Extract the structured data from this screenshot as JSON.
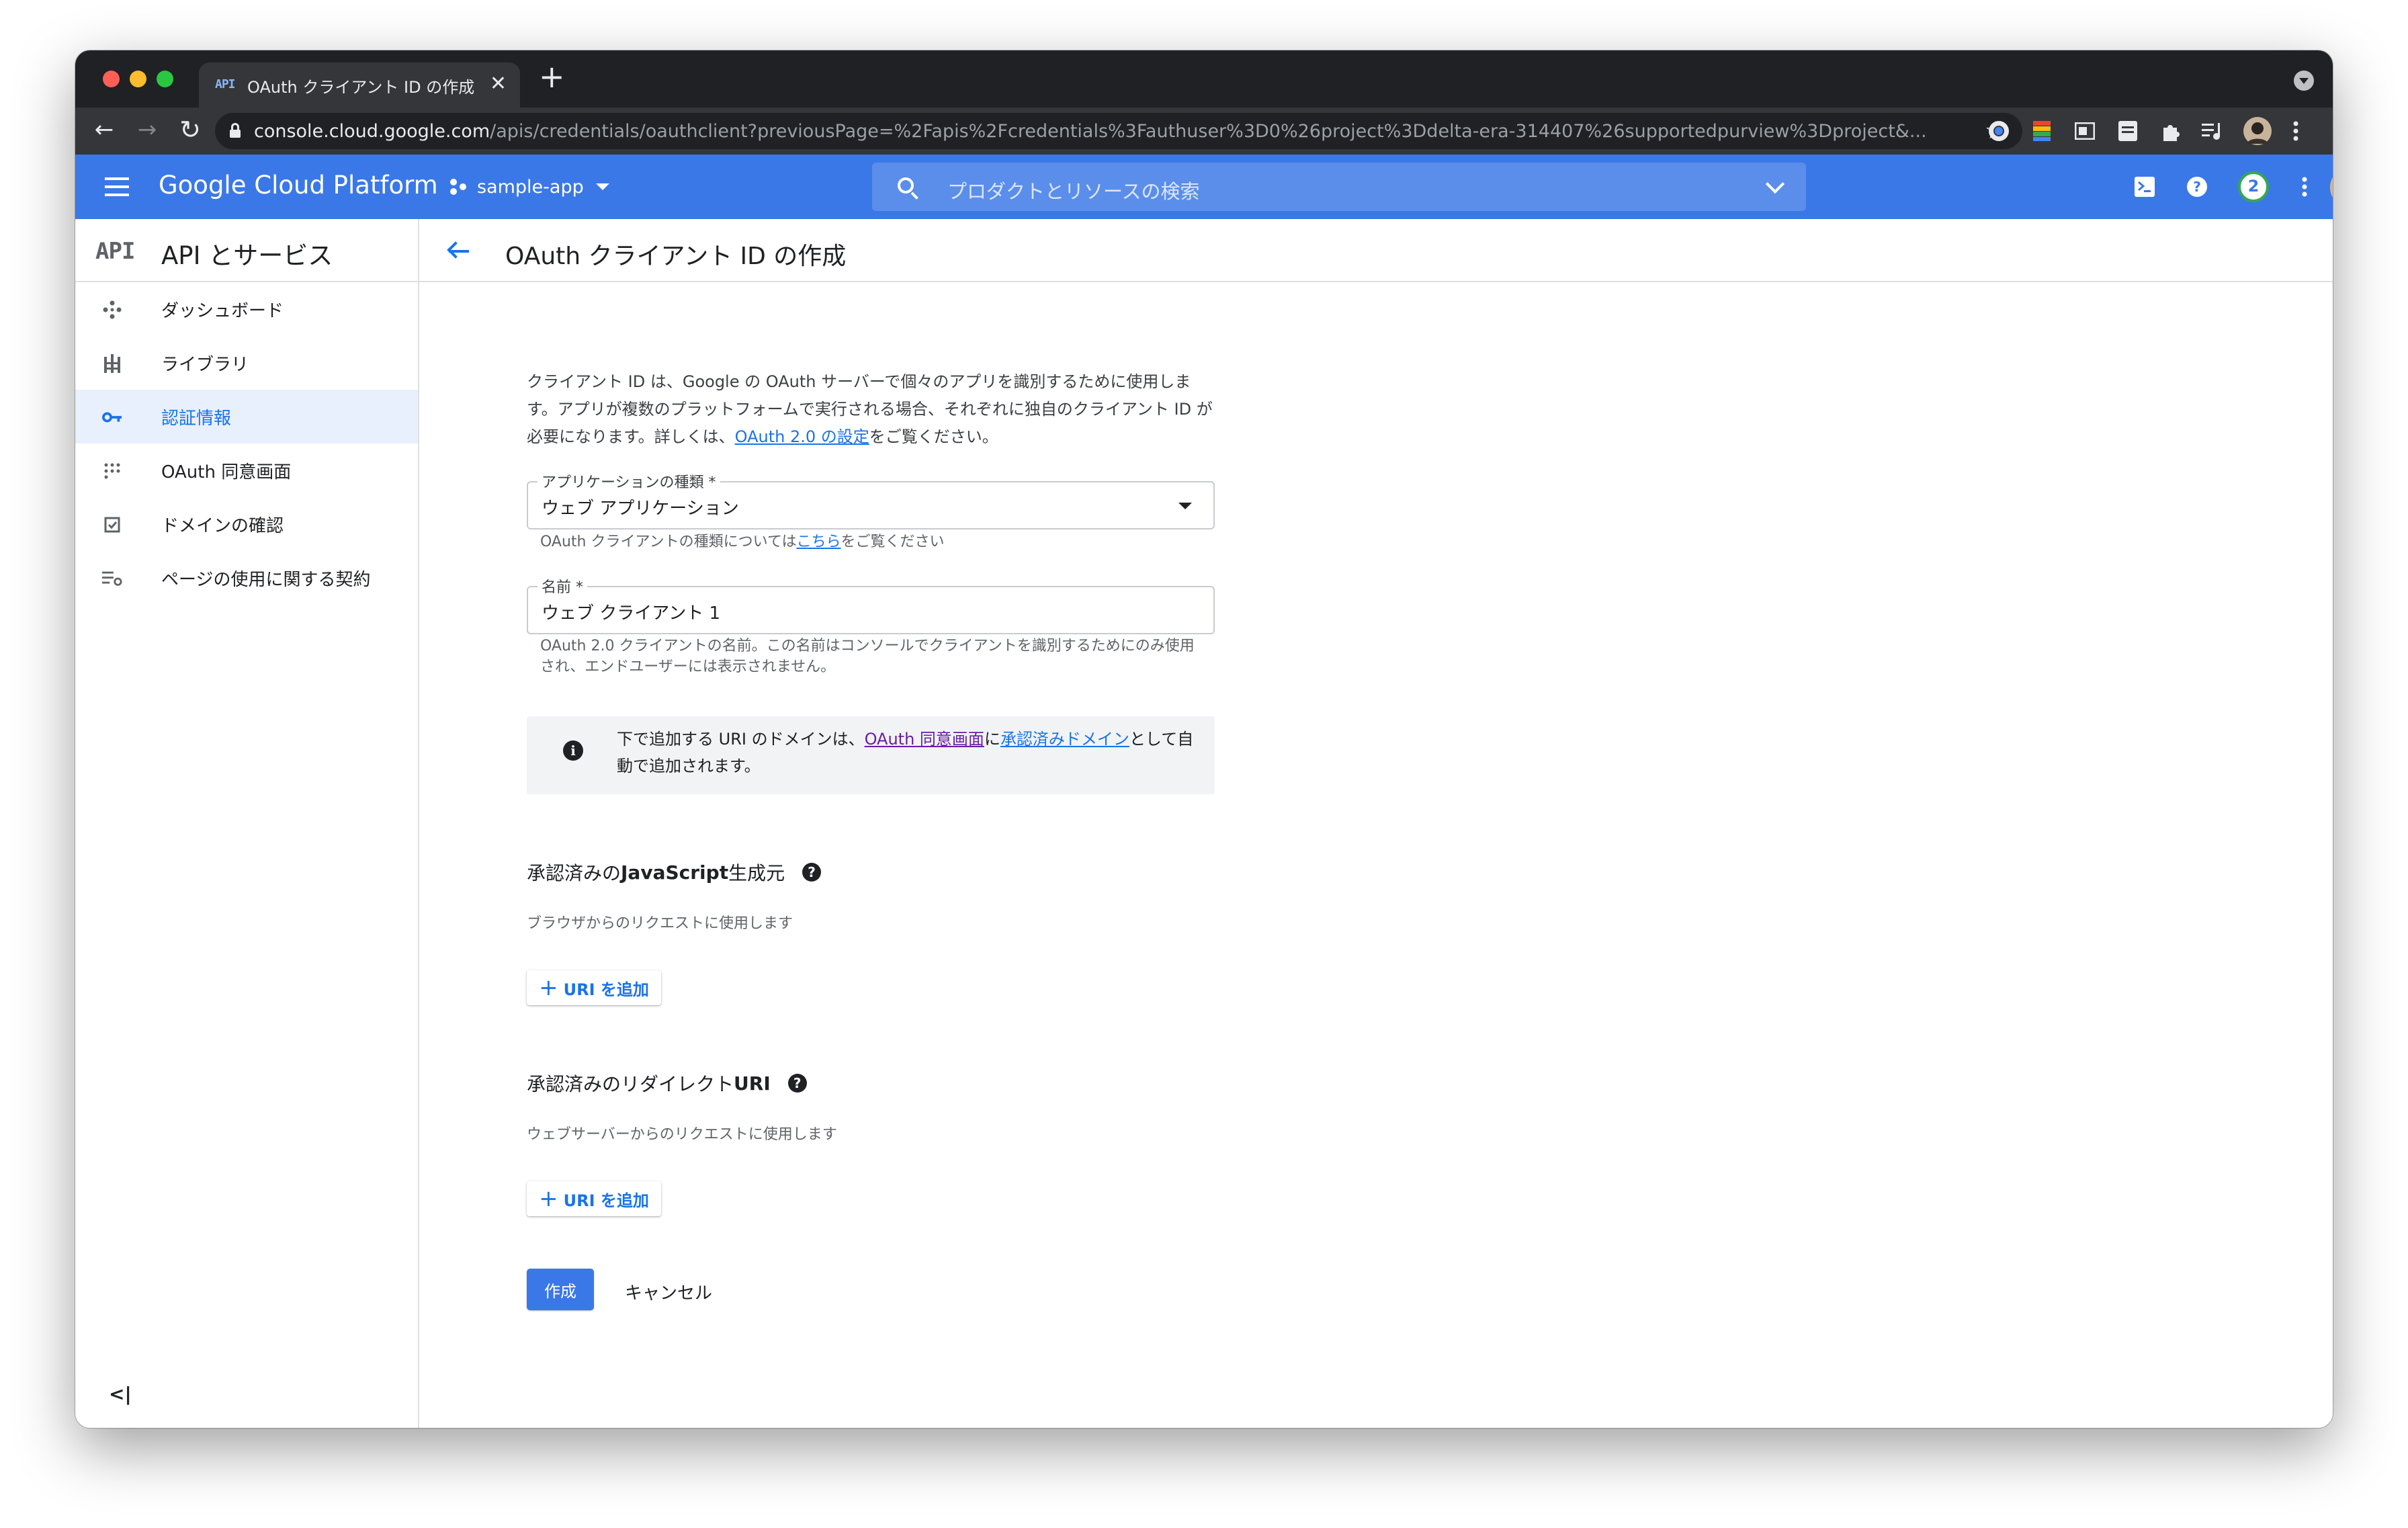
{
  "browser": {
    "tab_favicon": "API",
    "tab_title": "OAuth クライアント ID の作成 – /",
    "url_host": "console.cloud.google.com",
    "url_path": "/apis/credentials/oauthclient?previousPage=%2Fapis%2Fcredentials%3Fauthuser%3D0%26project%3Ddelta-era-314407%26supportedpurview%3Dproject&..."
  },
  "header": {
    "brand": "Google Cloud Platform",
    "project": "sample-app",
    "search_placeholder": "プロダクトとリソースの検索",
    "notification_count": "2"
  },
  "sidebar": {
    "logo": "API",
    "title": "API とサービス",
    "items": [
      {
        "label": "ダッシュボード",
        "icon": "dashboard-icon"
      },
      {
        "label": "ライブラリ",
        "icon": "library-icon"
      },
      {
        "label": "認証情報",
        "icon": "key-icon",
        "active": true
      },
      {
        "label": "OAuth 同意画面",
        "icon": "consent-icon"
      },
      {
        "label": "ドメインの確認",
        "icon": "checkbox-icon"
      },
      {
        "label": "ページの使用に関する契約",
        "icon": "settings-list-icon"
      }
    ],
    "collapse": "<|"
  },
  "page": {
    "title": "OAuth クライアント ID の作成",
    "intro_part1": "クライアント ID は、Google の OAuth サーバーで個々のアプリを識別するために使用します。アプリが複数のプラットフォームで実行される場合、それぞれに独自のクライアント ID が必要になります。詳しくは、",
    "intro_link": "OAuth 2.0 の設定",
    "intro_part2": "をご覧ください。",
    "app_type": {
      "label": "アプリケーションの種類 *",
      "value": "ウェブ アプリケーション",
      "hint_part1": "OAuth クライアントの種類については",
      "hint_link": "こちら",
      "hint_part2": "をご覧ください"
    },
    "name": {
      "label": "名前 *",
      "value": "ウェブ クライアント 1",
      "hint": "OAuth 2.0 クライアントの名前。この名前はコンソールでクライアントを識別するためにのみ使用され、エンドユーザーには表示されません。"
    },
    "info": {
      "part1": "下で追加する URI のドメインは、",
      "link1": "OAuth 同意画面",
      "part2": "に",
      "link2": "承認済みドメイン",
      "part3": "として自動で追加されます。"
    },
    "js_origins": {
      "title_part1": "承認済みの ",
      "title_bold": "JavaScript",
      "title_part2": " 生成元",
      "subtitle": "ブラウザからのリクエストに使用します",
      "add_label": "URI を追加"
    },
    "redirect_uris": {
      "title_part1": "承認済みのリダイレクト ",
      "title_bold": "URI",
      "subtitle": "ウェブサーバーからのリクエストに使用します",
      "add_label": "URI を追加"
    },
    "create_label": "作成",
    "cancel_label": "キャンセル"
  },
  "colors": {
    "header_blue": "#3b78e7",
    "link_blue": "#1a73e8",
    "link_purple": "#681da8",
    "active_nav_bg": "#e8f0fe"
  }
}
